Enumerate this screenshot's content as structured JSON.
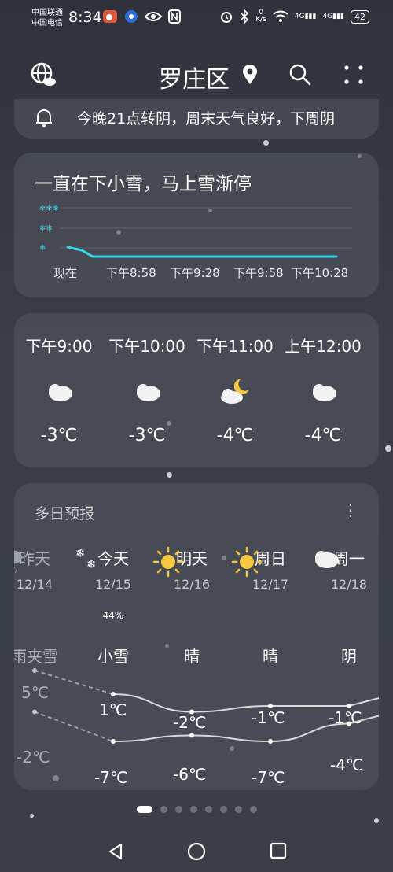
{
  "status_bar": {
    "carrier1": "中国联通",
    "carrier2": "中国电信",
    "time": "8:34",
    "net_speed_value": "0",
    "net_speed_unit": "K/s",
    "signal1": "4G",
    "signal2": "4G",
    "battery": "42"
  },
  "header": {
    "location": "罗庄区",
    "icons": [
      "globe-cloud-icon",
      "location-pin-icon",
      "search-icon",
      "more-icon"
    ]
  },
  "alert": {
    "text": "今晚21点转阴，周末天气良好，下周阴"
  },
  "precipitation": {
    "title": "一直在下小雪，马上雪渐停",
    "ticks": [
      "现在",
      "下午8:58",
      "下午9:28",
      "下午9:58",
      "下午10:28"
    ]
  },
  "hourly": [
    {
      "time": "下午9:00",
      "icon": "cloudy-icon",
      "temp": "-3℃"
    },
    {
      "time": "下午10:00",
      "icon": "cloudy-icon",
      "temp": "-3℃"
    },
    {
      "time": "下午11:00",
      "icon": "cloudy-night-icon",
      "temp": "-4℃"
    },
    {
      "time": "上午12:00",
      "icon": "cloudy-icon",
      "temp": "-4℃"
    }
  ],
  "daily": {
    "title": "多日预报",
    "menu": "⋮",
    "days": [
      {
        "name": "昨天",
        "date": "12/14",
        "icon": "sleet-icon",
        "cond": "雨夹雪",
        "precip": "",
        "high": "5℃",
        "low": "-2℃"
      },
      {
        "name": "今天",
        "date": "12/15",
        "icon": "snow-icon",
        "cond": "小雪",
        "precip": "44%",
        "high": "1℃",
        "low": "-7℃"
      },
      {
        "name": "明天",
        "date": "12/16",
        "icon": "sunny-icon",
        "cond": "晴",
        "precip": "",
        "high": "-2℃",
        "low": "-6℃"
      },
      {
        "name": "周日",
        "date": "12/17",
        "icon": "sunny-icon",
        "cond": "晴",
        "precip": "",
        "high": "-1℃",
        "low": "-7℃"
      },
      {
        "name": "周一",
        "date": "12/18",
        "icon": "cloudy-icon",
        "cond": "阴",
        "precip": "",
        "high": "-1℃",
        "low": "-4℃"
      }
    ],
    "high_values": [
      5,
      1,
      -2,
      -1,
      -1
    ],
    "low_values": [
      -2,
      -7,
      -6,
      -7,
      -4
    ]
  },
  "pager": {
    "count": 8,
    "active": 0
  },
  "navigation": [
    "back-icon",
    "home-icon",
    "recents-icon"
  ]
}
